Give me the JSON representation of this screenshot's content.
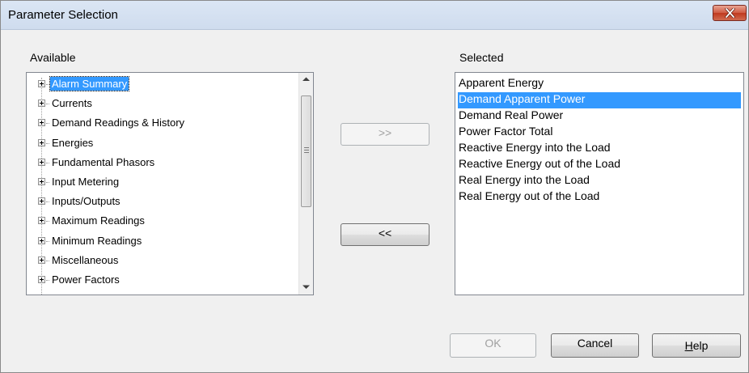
{
  "window": {
    "title": "Parameter Selection"
  },
  "available": {
    "label": "Available",
    "items": [
      {
        "label": "Alarm Summary",
        "selected": true
      },
      {
        "label": "Currents",
        "selected": false
      },
      {
        "label": "Demand Readings & History",
        "selected": false
      },
      {
        "label": "Energies",
        "selected": false
      },
      {
        "label": "Fundamental Phasors",
        "selected": false
      },
      {
        "label": "Input Metering",
        "selected": false
      },
      {
        "label": "Inputs/Outputs",
        "selected": false
      },
      {
        "label": "Maximum Readings",
        "selected": false
      },
      {
        "label": "Minimum Readings",
        "selected": false
      },
      {
        "label": "Miscellaneous",
        "selected": false
      },
      {
        "label": "Power Factors",
        "selected": false
      }
    ]
  },
  "selected_list": {
    "label": "Selected",
    "items": [
      {
        "label": "Apparent Energy",
        "selected": false
      },
      {
        "label": "Demand Apparent Power",
        "selected": true
      },
      {
        "label": "Demand Real Power",
        "selected": false
      },
      {
        "label": "Power Factor Total",
        "selected": false
      },
      {
        "label": "Reactive Energy into the Load",
        "selected": false
      },
      {
        "label": "Reactive Energy out of the Load",
        "selected": false
      },
      {
        "label": "Real Energy into the Load",
        "selected": false
      },
      {
        "label": "Real Energy out of the Load",
        "selected": false
      }
    ]
  },
  "buttons": {
    "add_label": ">>",
    "add_enabled": false,
    "remove_label": "<<",
    "remove_enabled": true,
    "ok_label": "OK",
    "ok_enabled": false,
    "cancel_label": "Cancel",
    "help_mnemonic": "H",
    "help_rest": "elp"
  },
  "icons": {
    "close": "close-icon",
    "expander": "plus-box-icon",
    "scroll_up": "scroll-up-arrow-icon",
    "scroll_down": "scroll-down-arrow-icon"
  },
  "colors": {
    "selection": "#3399ff",
    "close_button": "#c0391f"
  }
}
